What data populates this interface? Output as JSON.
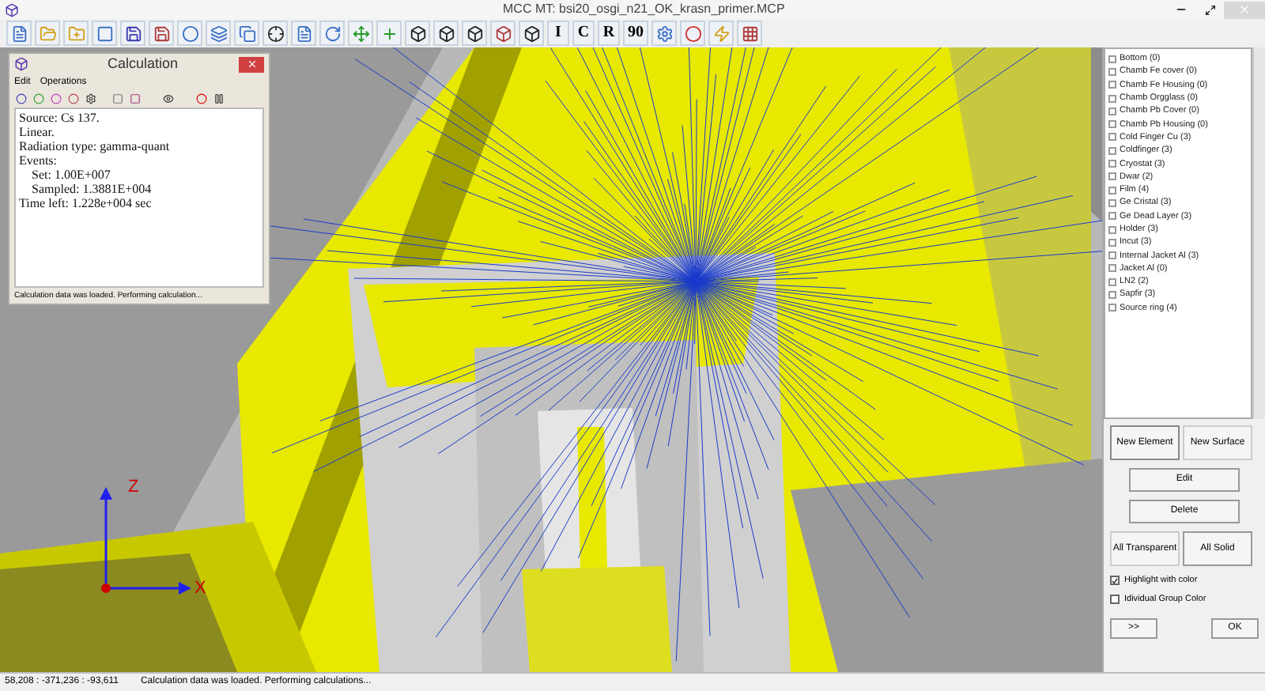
{
  "window": {
    "title": "MCC MT: bsi20_osgi_n21_OK_krasn_primer.MCP"
  },
  "toolbar": {
    "text_buttons": [
      "I",
      "C",
      "R",
      "90"
    ]
  },
  "viewport": {
    "axis_labels": [
      "Z",
      "X"
    ]
  },
  "calculation": {
    "title": "Calculation",
    "menu": [
      "Edit",
      "Operations"
    ],
    "lines": [
      {
        "text": "Source: Cs 137."
      },
      {
        "text": "Linear."
      },
      {
        "text": "Radiation type: gamma-quant"
      },
      {
        "text": "Events:",
        "children": [
          {
            "text": "Set: 1.00E+007"
          },
          {
            "text": "Sampled: 1.3881E+004"
          }
        ]
      },
      {
        "text": "Time left: 1.228e+004 sec"
      }
    ],
    "status": "Calculation data was loaded. Performing calculation..."
  },
  "tree": [
    {
      "label": "Bottom (0)"
    },
    {
      "label": "Chamb Fe cover (0)"
    },
    {
      "label": "Chamb Fe Housing (0)"
    },
    {
      "label": "Chamb Orgglass (0)"
    },
    {
      "label": "Chamb Pb Cover (0)"
    },
    {
      "label": "Chamb Pb Housing (0)"
    },
    {
      "label": "Cold Finger Cu (3)"
    },
    {
      "label": "Coldfinger (3)"
    },
    {
      "label": "Cryostat (3)"
    },
    {
      "label": "Dwar (2)"
    },
    {
      "label": "Film (4)"
    },
    {
      "label": "Ge Cristal (3)"
    },
    {
      "label": "Ge Dead Layer (3)"
    },
    {
      "label": "Holder (3)"
    },
    {
      "label": "Incut (3)"
    },
    {
      "label": "Internal Jacket Al (3)"
    },
    {
      "label": "Jacket Al (0)"
    },
    {
      "label": "LN2 (2)"
    },
    {
      "label": "Sapfir (3)"
    },
    {
      "label": "Source ring (4)"
    }
  ],
  "buttons": {
    "new_element": "New Element",
    "new_surface": "New Surface",
    "edit": "Edit",
    "delete": "Delete",
    "all_transparent": "All Transparent",
    "all_solid": "All Solid",
    "more": ">>",
    "ok": "OK"
  },
  "checkboxes": [
    {
      "label": "Highlight with color",
      "checked": true
    },
    {
      "label": "Idividual Group Color",
      "checked": false
    }
  ],
  "status_bar": {
    "coordinates": "58,208 : -371,236 : -93,611",
    "message": "Calculation data was loaded. Performing calculations..."
  }
}
